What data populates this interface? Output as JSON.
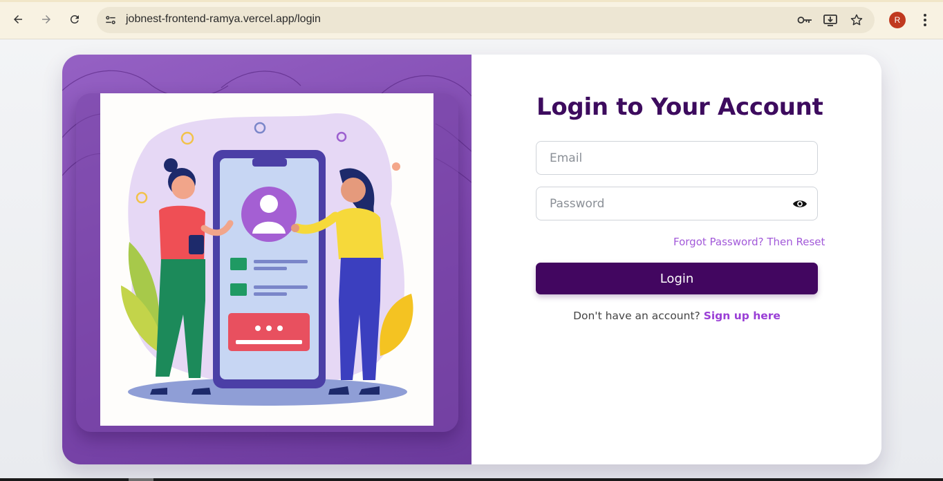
{
  "browser": {
    "url": "jobnest-frontend-ramya.vercel.app/login",
    "profile_initial": "R",
    "icons": [
      "back-icon",
      "forward-icon",
      "reload-icon",
      "site-info-icon",
      "password-key-icon",
      "install-app-icon",
      "bookmark-star-icon",
      "more-menu-icon"
    ]
  },
  "login": {
    "title": "Login to Your Account",
    "email_placeholder": "Email",
    "password_placeholder": "Password",
    "forgot_link": "Forgot Password? Then Reset",
    "login_button": "Login",
    "signup_prompt": "Don't have an account?",
    "signup_link": "Sign up here"
  },
  "colors": {
    "brand_dark": "#420660",
    "title": "#3d0b5e",
    "link": "#a259d9",
    "panel_purple": "#8a52b8"
  }
}
